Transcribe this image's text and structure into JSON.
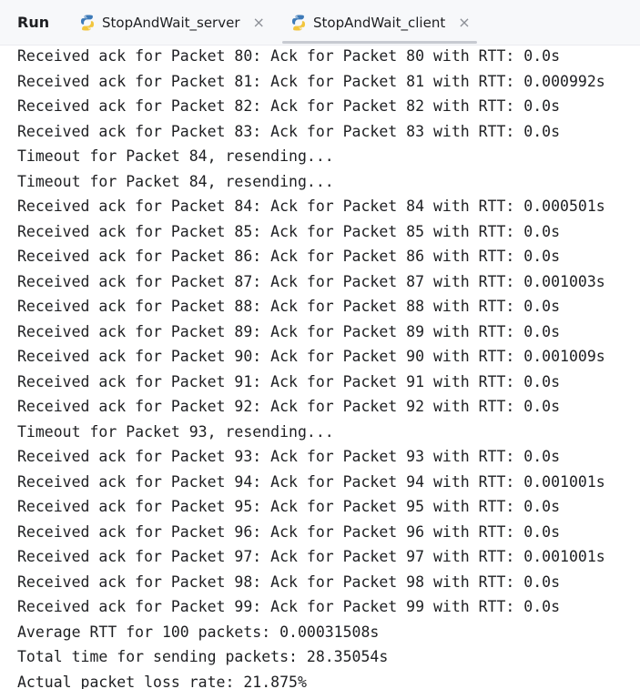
{
  "toolbar": {
    "run_label": "Run"
  },
  "tabs": [
    {
      "label": "StopAndWait_server",
      "icon": "python-icon",
      "close": "×",
      "active": false
    },
    {
      "label": "StopAndWait_client",
      "icon": "python-icon",
      "close": "×",
      "active": true
    }
  ],
  "colors": {
    "python_blue": "#3d7ab8",
    "python_yellow": "#f2c53d",
    "text": "#1e1f22"
  },
  "console": {
    "lines": [
      "Received ack for Packet 80: Ack for Packet 80 with RTT: 0.0s",
      "Received ack for Packet 81: Ack for Packet 81 with RTT: 0.000992s",
      "Received ack for Packet 82: Ack for Packet 82 with RTT: 0.0s",
      "Received ack for Packet 83: Ack for Packet 83 with RTT: 0.0s",
      "Timeout for Packet 84, resending...",
      "Timeout for Packet 84, resending...",
      "Received ack for Packet 84: Ack for Packet 84 with RTT: 0.000501s",
      "Received ack for Packet 85: Ack for Packet 85 with RTT: 0.0s",
      "Received ack for Packet 86: Ack for Packet 86 with RTT: 0.0s",
      "Received ack for Packet 87: Ack for Packet 87 with RTT: 0.001003s",
      "Received ack for Packet 88: Ack for Packet 88 with RTT: 0.0s",
      "Received ack for Packet 89: Ack for Packet 89 with RTT: 0.0s",
      "Received ack for Packet 90: Ack for Packet 90 with RTT: 0.001009s",
      "Received ack for Packet 91: Ack for Packet 91 with RTT: 0.0s",
      "Received ack for Packet 92: Ack for Packet 92 with RTT: 0.0s",
      "Timeout for Packet 93, resending...",
      "Received ack for Packet 93: Ack for Packet 93 with RTT: 0.0s",
      "Received ack for Packet 94: Ack for Packet 94 with RTT: 0.001001s",
      "Received ack for Packet 95: Ack for Packet 95 with RTT: 0.0s",
      "Received ack for Packet 96: Ack for Packet 96 with RTT: 0.0s",
      "Received ack for Packet 97: Ack for Packet 97 with RTT: 0.001001s",
      "Received ack for Packet 98: Ack for Packet 98 with RTT: 0.0s",
      "Received ack for Packet 99: Ack for Packet 99 with RTT: 0.0s",
      "Average RTT for 100 packets: 0.00031508s",
      "Total time for sending packets: 28.35054s",
      "Actual packet loss rate: 21.875%"
    ]
  }
}
